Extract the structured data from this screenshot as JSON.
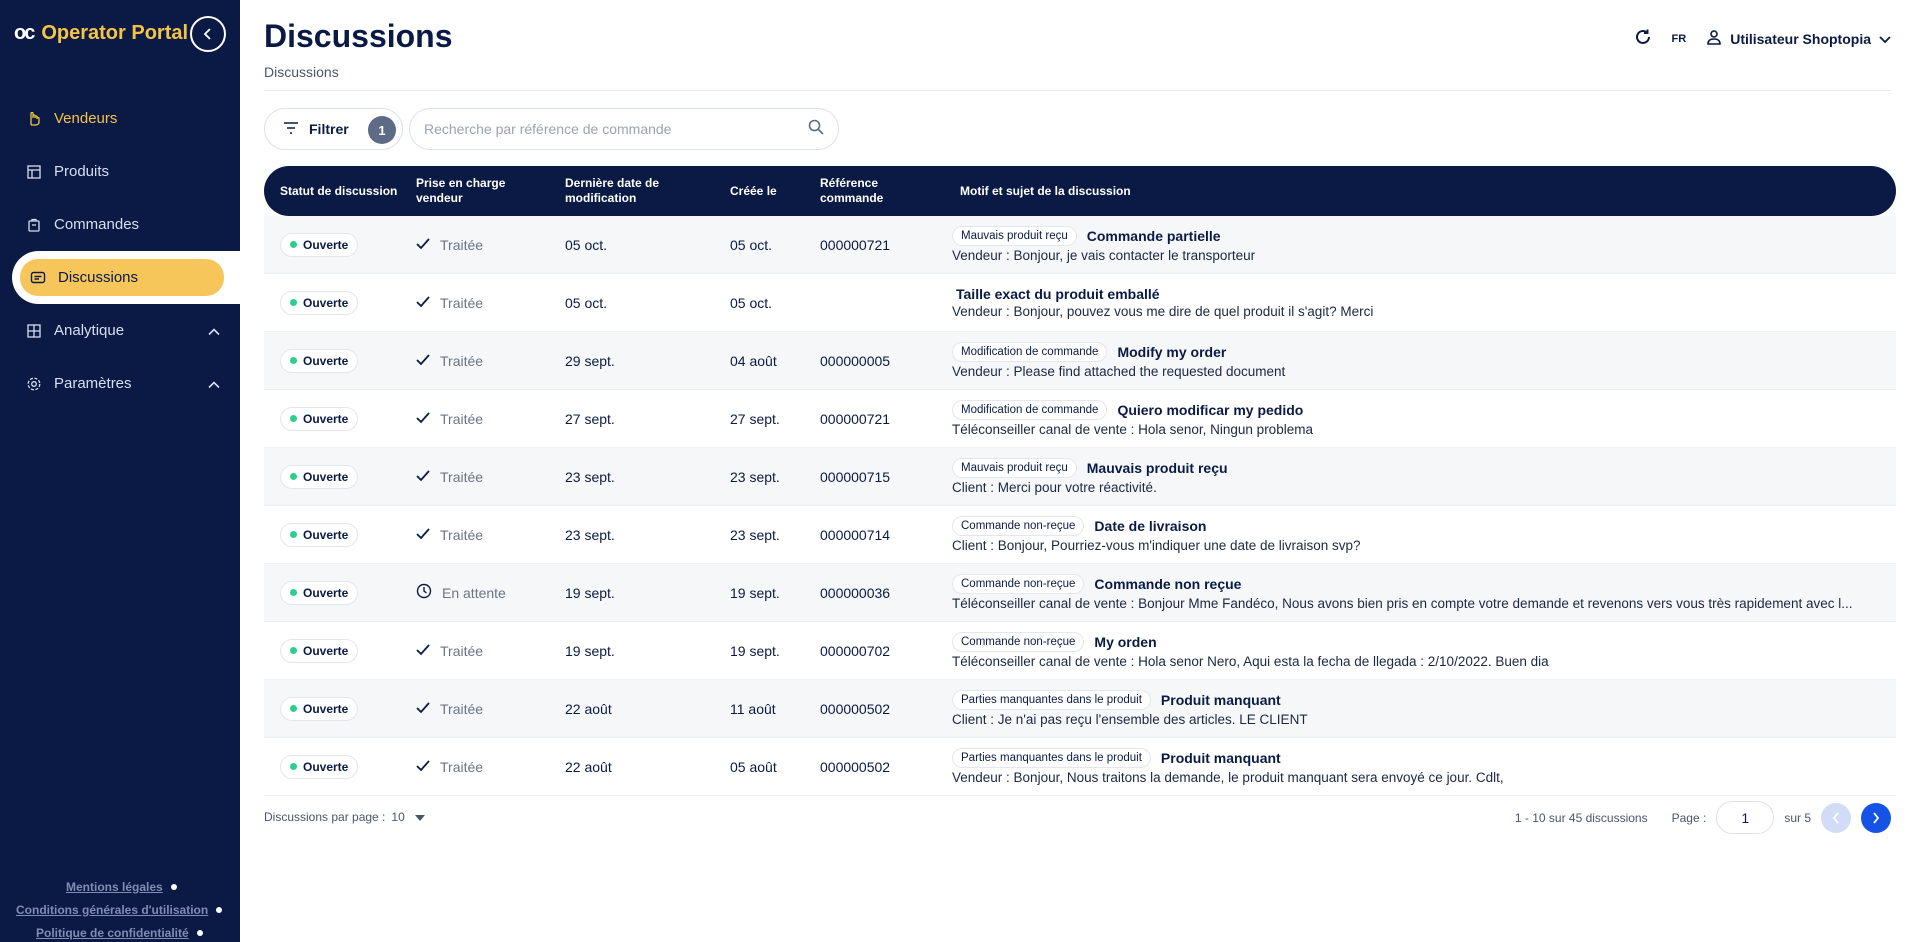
{
  "sidebar": {
    "logo_mark": "oc",
    "app_name": "Operator Portal",
    "items": [
      {
        "label": "Vendeurs",
        "icon": "hand-icon",
        "state": "highlighted"
      },
      {
        "label": "Produits",
        "icon": "box-icon"
      },
      {
        "label": "Commandes",
        "icon": "cart-icon"
      },
      {
        "label": "Discussions",
        "icon": "chat-icon",
        "state": "active"
      },
      {
        "label": "Analytique",
        "icon": "chart-icon",
        "expandable": true
      },
      {
        "label": "Paramètres",
        "icon": "gear-icon",
        "expandable": true
      }
    ],
    "footer": [
      "Mentions légales",
      "Conditions générales d'utilisation",
      "Politique de confidentialité"
    ]
  },
  "header": {
    "title": "Discussions",
    "breadcrumb": "Discussions",
    "lang": "FR",
    "user": "Utilisateur Shoptopia"
  },
  "toolbar": {
    "filter_label": "Filtrer",
    "filter_count": "1",
    "search_placeholder": "Recherche par référence de commande"
  },
  "table": {
    "columns": [
      "Statut de discussion",
      "Prise en charge vendeur",
      "Dernière date de modification",
      "Créée le",
      "Référence commande",
      "Motif et sujet de la discussion"
    ],
    "rows": [
      {
        "status": "Ouverte",
        "handled": "Traitée",
        "handled_icon": "check-icon",
        "modified": "05 oct.",
        "created": "05 oct.",
        "ref": "000000721",
        "motif": "Mauvais produit reçu",
        "subject": "Commande partielle",
        "message": "Vendeur : Bonjour, je vais contacter le transporteur"
      },
      {
        "status": "Ouverte",
        "handled": "Traitée",
        "handled_icon": "check-icon",
        "modified": "05 oct.",
        "created": "05 oct.",
        "ref": "",
        "motif": "",
        "subject": "Taille exact du produit emballé",
        "message": "Vendeur : Bonjour, pouvez vous me dire de quel produit il s'agit? Merci"
      },
      {
        "status": "Ouverte",
        "handled": "Traitée",
        "handled_icon": "check-icon",
        "modified": "29 sept.",
        "created": "04 août",
        "ref": "000000005",
        "motif": "Modification de commande",
        "subject": "Modify my order",
        "message": "Vendeur : Please find attached the requested document"
      },
      {
        "status": "Ouverte",
        "handled": "Traitée",
        "handled_icon": "check-icon",
        "modified": "27 sept.",
        "created": "27 sept.",
        "ref": "000000721",
        "motif": "Modification de commande",
        "subject": "Quiero modificar my pedido",
        "message": "Téléconseiller canal de vente : Hola senor, Ningun problema"
      },
      {
        "status": "Ouverte",
        "handled": "Traitée",
        "handled_icon": "check-icon",
        "modified": "23 sept.",
        "created": "23 sept.",
        "ref": "000000715",
        "motif": "Mauvais produit reçu",
        "subject": "Mauvais produit reçu",
        "message": "Client : Merci pour votre réactivité."
      },
      {
        "status": "Ouverte",
        "handled": "Traitée",
        "handled_icon": "check-icon",
        "modified": "23 sept.",
        "created": "23 sept.",
        "ref": "000000714",
        "motif": "Commande non-reçue",
        "subject": "Date de livraison",
        "message": "Client : Bonjour, Pourriez-vous m'indiquer une date de livraison svp?"
      },
      {
        "status": "Ouverte",
        "handled": "En attente",
        "handled_icon": "clock-icon",
        "modified": "19 sept.",
        "created": "19 sept.",
        "ref": "000000036",
        "motif": "Commande non-reçue",
        "subject": "Commande non reçue",
        "message": "Téléconseiller canal de vente : Bonjour Mme Fandéco, Nous avons bien pris en compte votre demande et revenons vers vous très rapidement avec l..."
      },
      {
        "status": "Ouverte",
        "handled": "Traitée",
        "handled_icon": "check-icon",
        "modified": "19 sept.",
        "created": "19 sept.",
        "ref": "000000702",
        "motif": "Commande non-reçue",
        "subject": "My orden",
        "message": "Téléconseiller canal de vente : Hola senor Nero, Aqui esta la fecha de llegada : 2/10/2022. Buen dia"
      },
      {
        "status": "Ouverte",
        "handled": "Traitée",
        "handled_icon": "check-icon",
        "modified": "22 août",
        "created": "11 août",
        "ref": "000000502",
        "motif": "Parties manquantes dans le produit",
        "subject": "Produit manquant",
        "message": "Client : Je n'ai pas reçu l'ensemble des articles. LE CLIENT"
      },
      {
        "status": "Ouverte",
        "handled": "Traitée",
        "handled_icon": "check-icon",
        "modified": "22 août",
        "created": "05 août",
        "ref": "000000502",
        "motif": "Parties manquantes dans le produit",
        "subject": "Produit manquant",
        "message": "Vendeur : Bonjour, Nous traitons la demande, le produit manquant sera envoyé ce jour. Cdlt,"
      }
    ]
  },
  "pagination": {
    "per_page_label": "Discussions par page :",
    "per_page": "10",
    "range": "1 - 10 sur 45 discussions",
    "page_label": "Page :",
    "page": "1",
    "total": "sur 5"
  },
  "colors": {
    "navy": "#0a1a44",
    "gold": "#f6c343",
    "active_pill": "#f6c65b",
    "status_green": "#2ecf8d",
    "next_blue": "#1553e6"
  }
}
